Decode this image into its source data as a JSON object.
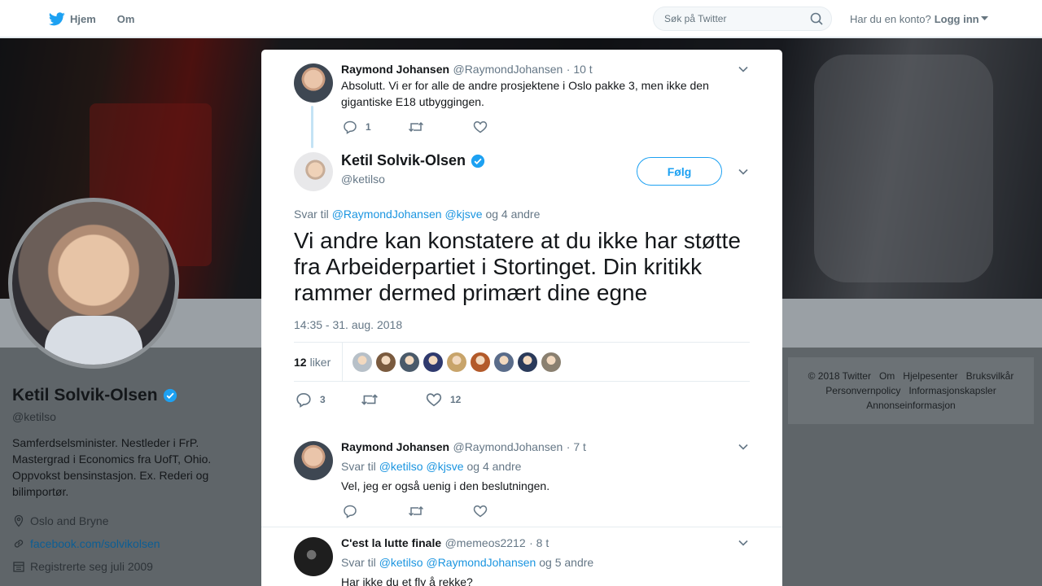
{
  "nav": {
    "home_label": "Hjem",
    "about_label": "Om",
    "search_placeholder": "Søk på Twitter",
    "account_prompt": "Har du en konto?",
    "login_label": "Logg inn"
  },
  "profile": {
    "name": "Ketil Solvik-Olsen",
    "handle": "@ketilso",
    "bio": "Samferdselsminister. Nestleder i FrP. Mastergrad i Economics fra UofT, Ohio. Oppvokst bensinstasjon. Ex. Rederi og bilimportør.",
    "location": "Oslo and Bryne",
    "link": "facebook.com/solvikolsen",
    "joined": "Registrerte seg juli 2009"
  },
  "footer": {
    "items": [
      "© 2018 Twitter",
      "Om",
      "Hjelpesenter",
      "Bruksvilkår",
      "Personvernpolicy",
      "Informasjonskapsler",
      "Annonseinformasjon"
    ]
  },
  "thread": {
    "parent": {
      "name": "Raymond Johansen",
      "handle": "@RaymondJohansen",
      "time": "· 10 t",
      "text": "Absolutt. Vi er for alle de andre prosjektene i Oslo pakke 3, men ikke den gigantiske E18 utbyggingen.",
      "replies": "1"
    },
    "main": {
      "name": "Ketil Solvik-Olsen",
      "handle": "@ketilso",
      "follow_label": "Følg",
      "reply_prefix": "Svar til",
      "reply_mention1": "@RaymondJohansen",
      "reply_mention2": "@kjsve",
      "reply_suffix": "og 4 andre",
      "text": "Vi andre kan konstatere at du ikke har støtte fra Arbeiderpartiet i Stortinget. Din kritikk rammer dermed primært dine egne",
      "timestamp": "14:35 - 31. aug. 2018",
      "likes_count": "12",
      "likes_label": "liker",
      "replies": "3",
      "likes": "12",
      "liker_colors": [
        "#b7c0c8",
        "#7a5a3e",
        "#4a5a6a",
        "#2f3a6e",
        "#c8a46a",
        "#b35a2a",
        "#5a6c8a",
        "#2a3a5a",
        "#8a8070"
      ]
    },
    "reply1": {
      "name": "Raymond Johansen",
      "handle": "@RaymondJohansen",
      "time": "· 7 t",
      "reply_prefix": "Svar til",
      "reply_mention1": "@ketilso",
      "reply_mention2": "@kjsve",
      "reply_suffix": "og 4 andre",
      "text": "Vel, jeg er også uenig i den beslutningen."
    },
    "reply2": {
      "name": "C'est la lutte finale",
      "handle": "@memeos2212",
      "time": "· 8 t",
      "reply_prefix": "Svar til",
      "reply_mention1": "@ketilso",
      "reply_mention2": "@RaymondJohansen",
      "reply_suffix": "og 5 andre",
      "text": "Har ikke du et fly å rekke?"
    }
  }
}
